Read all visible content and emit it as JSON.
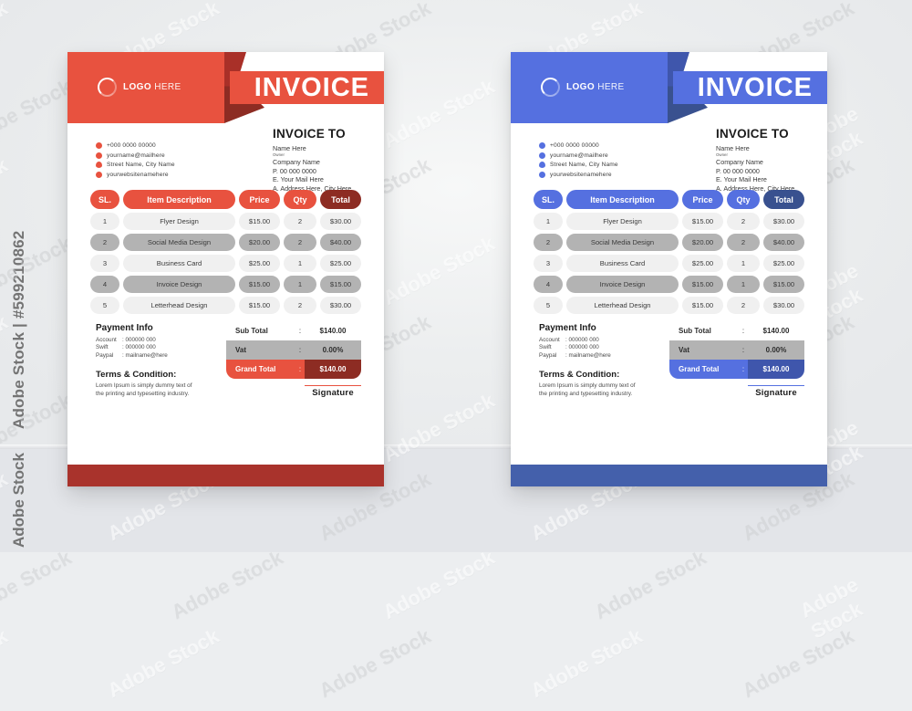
{
  "stock": {
    "id_watermark": "Adobe Stock | #599210862",
    "bottom_watermark": "Adobe Stock",
    "tile_watermark": "Adobe Stock"
  },
  "theme": {
    "red": {
      "accent": "#e8523f",
      "accent_dark": "#a93028",
      "accent_deep": "#8d2c23",
      "footer": "#a9332c",
      "total_head": "#8d2c23",
      "grand_right": "#8d2c23"
    },
    "blue": {
      "accent": "#5570e0",
      "accent_dark": "#3f56ac",
      "accent_deep": "#39518f",
      "footer": "#4460ab",
      "total_head": "#39518f",
      "grand_right": "#3f56ac"
    },
    "row_odd": "#f0f0f0",
    "row_even": "#b3b3b3"
  },
  "invoice": {
    "logo": {
      "bold": "LOGO",
      "light": "HERE"
    },
    "title": "INVOICE",
    "contact": [
      {
        "icon": "phone-icon",
        "text": "+000 0000 00000"
      },
      {
        "icon": "envelope-icon",
        "text": "yourname@mailhere"
      },
      {
        "icon": "location-pin-icon",
        "text": "Street Name, City Name"
      },
      {
        "icon": "globe-icon",
        "text": "yourwebsitenamehere"
      }
    ],
    "invoice_to": {
      "heading": "INVOICE TO",
      "name": "Name Here",
      "role": "Owner",
      "company": "Company Name",
      "phone": "P. 00 000 0000",
      "email": "E. Your Mail Here",
      "address": "A. Address Here, City Here"
    },
    "table": {
      "headers": [
        "SL.",
        "Item Description",
        "Price",
        "Qty",
        "Total"
      ],
      "rows": [
        {
          "sl": "1",
          "desc": "Flyer Design",
          "price": "$15.00",
          "qty": "2",
          "total": "$30.00"
        },
        {
          "sl": "2",
          "desc": "Social Media Design",
          "price": "$20.00",
          "qty": "2",
          "total": "$40.00"
        },
        {
          "sl": "3",
          "desc": "Business Card",
          "price": "$25.00",
          "qty": "1",
          "total": "$25.00"
        },
        {
          "sl": "4",
          "desc": "Invoice Design",
          "price": "$15.00",
          "qty": "1",
          "total": "$15.00"
        },
        {
          "sl": "5",
          "desc": "Letterhead Design",
          "price": "$15.00",
          "qty": "2",
          "total": "$30.00"
        }
      ]
    },
    "totals": {
      "sub_label": "Sub Total",
      "sub_value": "$140.00",
      "vat_label": "Vat",
      "vat_value": "0.00%",
      "grand_label": "Grand Total",
      "grand_value": "$140.00",
      "colon": ":"
    },
    "payment": {
      "heading": "Payment Info",
      "rows": [
        {
          "key": "Account",
          "value": ": 000000 000"
        },
        {
          "key": "Swift",
          "value": ": 000000 000"
        },
        {
          "key": "Paypal",
          "value": ": mailname@here"
        }
      ]
    },
    "terms": {
      "heading": "Terms & Condition:",
      "line1": "Lorem Ipsum is simply dummy text of",
      "line2": "the printing and typesetting industry."
    },
    "signature": "Signature"
  }
}
